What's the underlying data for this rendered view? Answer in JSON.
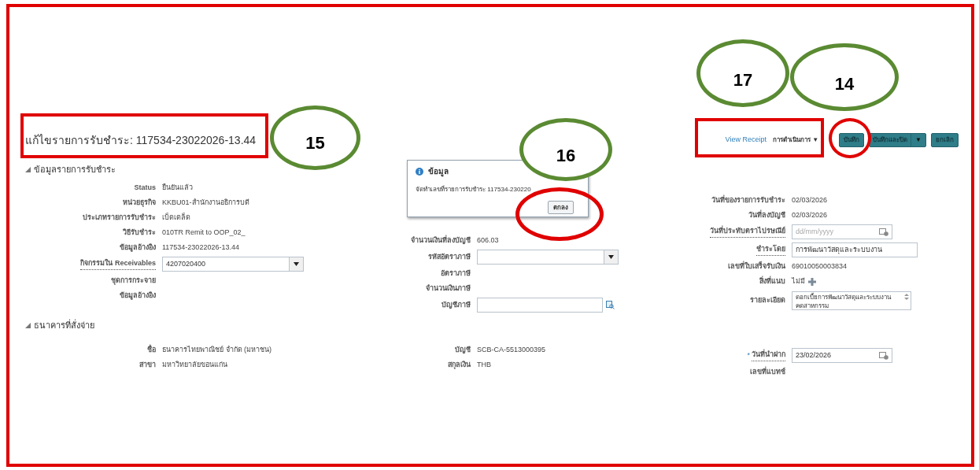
{
  "page_title": "แก้ไขรายการรับชำระ: 117534-23022026-13.44",
  "header_actions": {
    "link": "View Receipt",
    "menu": {
      "label": "การดำเนินการ",
      "caret": "▼"
    },
    "buttons": [
      {
        "label": "บันทึก",
        "kind": "plain"
      },
      {
        "label": "บันทึกและปิด",
        "kind": "split",
        "caret": "▼"
      },
      {
        "label": "ยกเลิก",
        "kind": "plain"
      }
    ]
  },
  "sections": [
    {
      "title": "ข้อมูลรายการรับชำระ",
      "expanded": true,
      "columns": [
        [
          {
            "label": "Status",
            "kind": "text",
            "value": "ยืนยันแล้ว",
            "underlined": false
          },
          {
            "label": "หน่วยธุรกิจ",
            "kind": "text",
            "value": "KKBU01-สำนักงานอธิการบดี",
            "underlined": false
          },
          {
            "label": "ประเภทรายการรับชำระ",
            "kind": "text",
            "value": "เบ็ดเตล็ด",
            "underlined": false
          },
          {
            "label": "วิธีรับชำระ",
            "kind": "text",
            "value": "010TR Remit to OOP_02_",
            "underlined": false
          },
          {
            "label": "ข้อมูลอ้างอิง",
            "kind": "text",
            "value": "117534-23022026-13.44",
            "underlined": false
          },
          {
            "label": "กิจกรรมใน Receivables",
            "kind": "select",
            "value": "4207020400",
            "underlined": true
          },
          {
            "label": "ชุดการกระจาย",
            "kind": "text",
            "underlined": false
          },
          {
            "label": "ข้อมูลอ้างอิง",
            "kind": "text",
            "underlined": false
          }
        ],
        [
          {
            "label": "จำนวนเงินที่ลงบัญชี",
            "kind": "text",
            "value": "606.03",
            "underlined": false
          },
          {
            "label": "รหัสอัตราภาษี",
            "kind": "select",
            "underlined": false
          },
          {
            "label": "อัตราภาษี",
            "kind": "text",
            "underlined": false
          },
          {
            "label": "จำนวนเงินภาษี",
            "kind": "text",
            "underlined": false
          },
          {
            "label": "บัญชีภาษี",
            "kind": "lookup",
            "underlined": false
          }
        ],
        [
          {
            "label": "วันที่ของรายการรับชำระ",
            "kind": "text",
            "value": "02/03/2026",
            "underlined": false
          },
          {
            "label": "วันที่ลงบัญชี",
            "kind": "text",
            "value": "02/03/2026",
            "underlined": false
          },
          {
            "label": "วันที่ประทับตราไปรษณีย์",
            "kind": "date",
            "placeholder": "dd/mm/yyyy",
            "underlined": true
          },
          {
            "label": "ชำระโดย",
            "kind": "input",
            "value": "การพัฒนาวัสดุและระบบงาน",
            "underlined": true
          },
          {
            "label": "เลขที่ใบเสร็จรับเงิน",
            "kind": "text",
            "value": "69010050003834",
            "underlined": false
          },
          {
            "label": "สิ่งที่แนบ",
            "kind": "attachment",
            "value": "ไม่มี",
            "underlined": false
          },
          {
            "label": "รายละเอียด",
            "kind": "textarea",
            "value": "ดอกเบี้ยการพัฒนาวัสดุและระบบงาน\nคดสาหกรรม",
            "underlined": false
          }
        ]
      ]
    },
    {
      "title": "ธนาคารที่สั่งจ่าย",
      "expanded": true,
      "columns": [
        [
          {
            "label": "ชื่อ",
            "kind": "text",
            "value": "ธนาคารไทยพาณิชย์ จำกัด (มหาชน)",
            "underlined": false
          },
          {
            "label": "สาขา",
            "kind": "text",
            "value": "มหาวิทยาลัยขอนแก่น",
            "underlined": false
          }
        ],
        [
          {
            "label": "บัญชี",
            "kind": "text",
            "value": "SCB-CA-5513000395",
            "underlined": false
          },
          {
            "label": "สกุลเงิน",
            "kind": "text",
            "value": "THB",
            "underlined": false
          }
        ],
        [
          {
            "label": "วันที่นำฝาก",
            "kind": "date",
            "value": "23/02/2026",
            "marker": "*",
            "underlined": true
          },
          {
            "label": "เลขที่แบทช์",
            "kind": "text",
            "underlined": false
          }
        ]
      ]
    }
  ],
  "dialog": {
    "title": "ข้อมูล",
    "message": "จัดทำเลขที่รายการรับชำระ 117534-230220",
    "button": "ตกลง"
  },
  "callouts": [
    {
      "label": "17"
    },
    {
      "label": "14"
    },
    {
      "label": "15"
    },
    {
      "label": "16"
    }
  ]
}
